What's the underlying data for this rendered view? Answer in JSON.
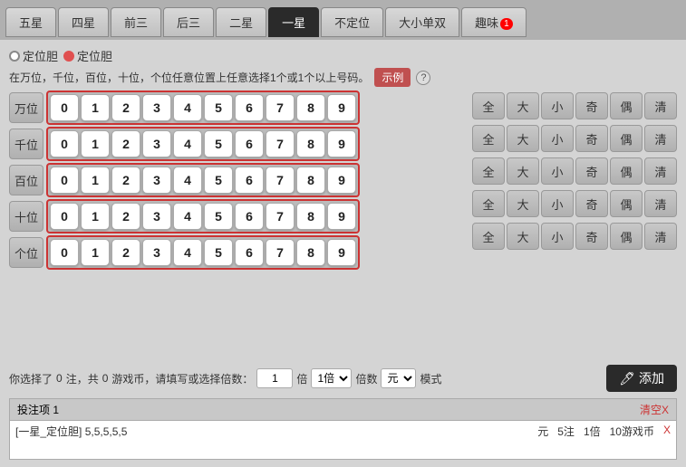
{
  "nav": {
    "tabs": [
      {
        "label": "五星",
        "active": false
      },
      {
        "label": "四星",
        "active": false
      },
      {
        "label": "前三",
        "active": false
      },
      {
        "label": "后三",
        "active": false
      },
      {
        "label": "二星",
        "active": false
      },
      {
        "label": "一星",
        "active": true
      },
      {
        "label": "不定位",
        "active": false
      },
      {
        "label": "大小单双",
        "active": false
      },
      {
        "label": "趣味",
        "active": false,
        "badge": "1"
      }
    ]
  },
  "radio": {
    "options": [
      "定位胆",
      "定位胆"
    ],
    "selected": 1
  },
  "desc": {
    "text": "在万位，千位，百位，十位，个位任意位置上任意选择1个或1个以上号码。",
    "example_btn": "示例",
    "help": "?"
  },
  "rows": [
    {
      "label": "万位",
      "numbers": [
        "0",
        "1",
        "2",
        "3",
        "4",
        "5",
        "6",
        "7",
        "8",
        "9"
      ]
    },
    {
      "label": "千位",
      "numbers": [
        "0",
        "1",
        "2",
        "3",
        "4",
        "5",
        "6",
        "7",
        "8",
        "9"
      ]
    },
    {
      "label": "百位",
      "numbers": [
        "0",
        "1",
        "2",
        "3",
        "4",
        "5",
        "6",
        "7",
        "8",
        "9"
      ]
    },
    {
      "label": "十位",
      "numbers": [
        "0",
        "1",
        "2",
        "3",
        "4",
        "5",
        "6",
        "7",
        "8",
        "9"
      ]
    },
    {
      "label": "个位",
      "numbers": [
        "0",
        "1",
        "2",
        "3",
        "4",
        "5",
        "6",
        "7",
        "8",
        "9"
      ]
    }
  ],
  "attr_buttons": [
    "全",
    "大",
    "小",
    "奇",
    "偶",
    "清"
  ],
  "info_bar": {
    "text1": "你选择了",
    "count": "0",
    "text2": "注，共",
    "coins": "0",
    "text3": "游戏币，请填写或选择倍数：",
    "input_val": "1",
    "select1": "1倍",
    "text4": "倍数",
    "select2": "元",
    "text5": "模式",
    "add_label": "添加"
  },
  "bet_list": {
    "header": "投注项  1",
    "clear_label": "清空X",
    "items": [
      {
        "tag": "[一星_定位胆]",
        "numbers": "5,5,5,5,5",
        "currency": "元",
        "bets": "5注",
        "times": "1倍",
        "coins": "10游戏币",
        "close": "X"
      }
    ]
  },
  "icons": {
    "add_icon": "🖊"
  }
}
